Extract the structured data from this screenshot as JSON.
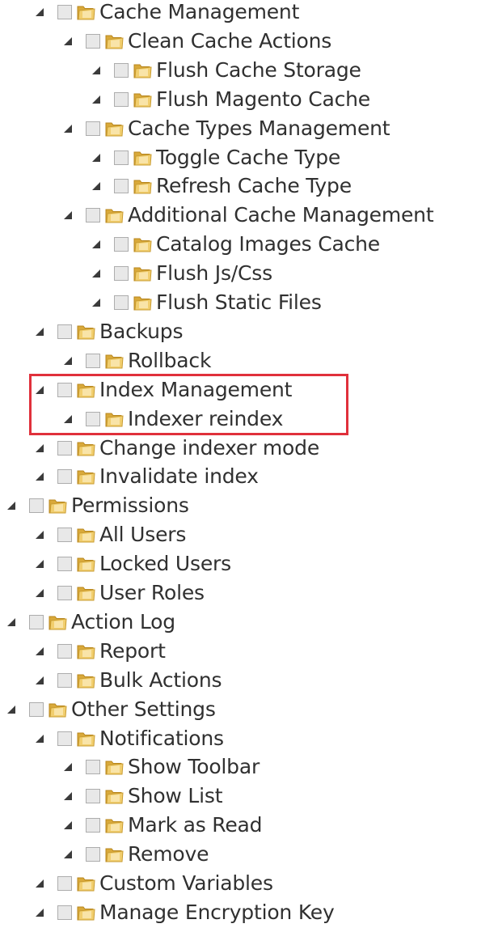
{
  "tree": {
    "items": [
      {
        "label": "Cache Management",
        "level": 1
      },
      {
        "label": "Clean Cache Actions",
        "level": 2
      },
      {
        "label": "Flush Cache Storage",
        "level": 3
      },
      {
        "label": "Flush Magento Cache",
        "level": 3
      },
      {
        "label": "Cache Types Management",
        "level": 2
      },
      {
        "label": "Toggle Cache Type",
        "level": 3
      },
      {
        "label": "Refresh Cache Type",
        "level": 3
      },
      {
        "label": "Additional Cache Management",
        "level": 2
      },
      {
        "label": "Catalog Images Cache",
        "level": 3
      },
      {
        "label": "Flush Js/Css",
        "level": 3
      },
      {
        "label": "Flush Static Files",
        "level": 3
      },
      {
        "label": "Backups",
        "level": 1
      },
      {
        "label": "Rollback",
        "level": 2
      },
      {
        "label": "Index Management",
        "level": 1
      },
      {
        "label": "Indexer reindex",
        "level": 2
      },
      {
        "label": "Change indexer mode",
        "level": 1
      },
      {
        "label": "Invalidate index",
        "level": 1
      },
      {
        "label": "Permissions",
        "level": 0
      },
      {
        "label": "All Users",
        "level": 1
      },
      {
        "label": "Locked Users",
        "level": 1
      },
      {
        "label": "User Roles",
        "level": 1
      },
      {
        "label": "Action Log",
        "level": 0
      },
      {
        "label": "Report",
        "level": 1
      },
      {
        "label": "Bulk Actions",
        "level": 1
      },
      {
        "label": "Other Settings",
        "level": 0
      },
      {
        "label": "Notifications",
        "level": 1
      },
      {
        "label": "Show Toolbar",
        "level": 2
      },
      {
        "label": "Show List",
        "level": 2
      },
      {
        "label": "Mark as Read",
        "level": 2
      },
      {
        "label": "Remove",
        "level": 2
      },
      {
        "label": "Custom Variables",
        "level": 1
      },
      {
        "label": "Manage Encryption Key",
        "level": 1
      }
    ]
  },
  "colors": {
    "highlight": "#e0303b",
    "text": "#303030",
    "checkbox": "#e8e8e8"
  }
}
